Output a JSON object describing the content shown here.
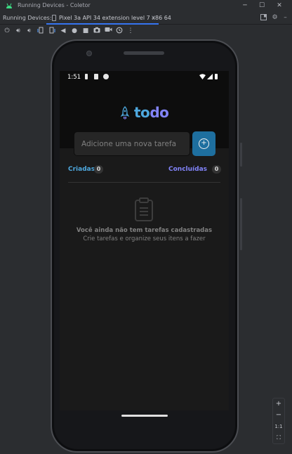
{
  "window": {
    "title": "Running Devices - Coletor",
    "minimize": "─",
    "maximize": "☐",
    "close": "✕"
  },
  "tabbar": {
    "label": "Running Devices:",
    "tab_title": "Pixel 3a API 34 extension level 7 x86 64",
    "tab_close": "×"
  },
  "toolbar": {
    "icons": [
      "power-icon",
      "volume-up-icon",
      "volume-down-icon",
      "rotate-left-icon",
      "rotate-right-icon",
      "back-icon",
      "home-icon",
      "overview-icon",
      "screenshot-icon",
      "record-icon",
      "rewind-icon",
      "more-icon"
    ]
  },
  "phone": {
    "status_time": "1:51",
    "app": {
      "logo_part1": "to",
      "logo_part2": "do",
      "input_placeholder": "Adicione uma nova tarefa",
      "add_button_glyph": "+",
      "created_label": "Criadas",
      "created_count": "0",
      "done_label": "Concluídas",
      "done_count": "0",
      "empty_title": "Você ainda não tem tarefas cadastradas",
      "empty_subtitle": "Crie tarefas e organize seus itens a fazer"
    }
  },
  "zoom_controls": {
    "zoom_in": "+",
    "zoom_out": "−",
    "actual_size": "1:1",
    "fit": "⛶"
  },
  "colors": {
    "accent_blue": "#4ea8de",
    "accent_purple": "#8284fa",
    "button_blue": "#1e6f9f",
    "ide_bg": "#2b2d30",
    "tab_underline": "#3574f0"
  }
}
